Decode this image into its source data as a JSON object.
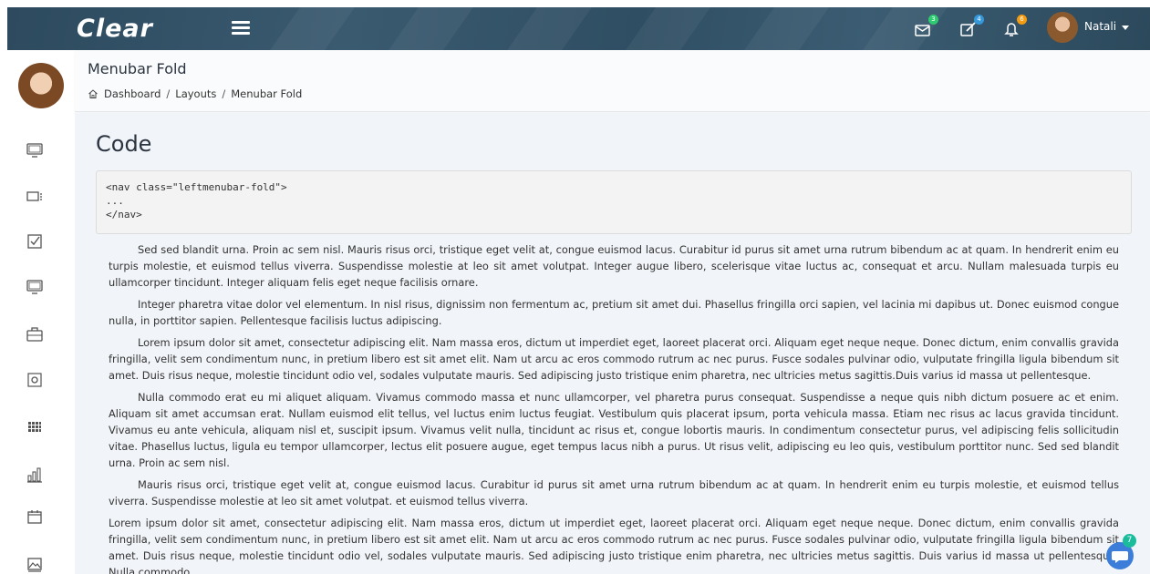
{
  "app": {
    "logo": "Clear"
  },
  "topbar": {
    "mail_badge": "3",
    "edit_badge": "4",
    "bell_badge": "6",
    "user_name": "Natali",
    "colors": {
      "mail_badge": "#2ecc71",
      "edit_badge": "#3498db",
      "bell_badge": "#f39c12"
    }
  },
  "header": {
    "title": "Menubar Fold",
    "breadcrumb": [
      "Dashboard",
      "Layouts",
      "Menubar Fold"
    ],
    "separator": "/"
  },
  "sidebar": {
    "icons": [
      "monitor-icon",
      "tag-icon",
      "checkbox-icon",
      "screen-icon",
      "briefcase-icon",
      "settings-icon",
      "grid-icon",
      "bar-chart-icon",
      "calendar-icon",
      "image-icon"
    ]
  },
  "content": {
    "section_title": "Code",
    "code": "<nav class=\"leftmenubar-fold\">\n...\n</nav>",
    "paragraphs": [
      "Sed sed blandit urna. Proin ac sem nisl. Mauris risus orci, tristique eget velit at, congue euismod lacus. Curabitur id purus sit amet urna rutrum bibendum ac at quam. In hendrerit enim eu turpis molestie, et euismod tellus viverra. Suspendisse molestie at leo sit amet volutpat. Integer augue libero, scelerisque vitae luctus ac, consequat et arcu. Nullam malesuada turpis eu ullamcorper tincidunt. Integer aliquam felis eget neque facilisis ornare.",
      "Integer pharetra vitae dolor vel elementum. In nisl risus, dignissim non fermentum ac, pretium sit amet dui. Phasellus fringilla orci sapien, vel lacinia mi dapibus ut. Donec euismod congue nulla, in porttitor sapien. Pellentesque facilisis luctus adipiscing.",
      "Lorem ipsum dolor sit amet, consectetur adipiscing elit. Nam massa eros, dictum ut imperdiet eget, laoreet placerat orci. Aliquam eget neque neque. Donec dictum, enim convallis gravida fringilla, velit sem condimentum nunc, in pretium libero est sit amet elit. Nam ut arcu ac eros commodo rutrum ac nec purus. Fusce sodales pulvinar odio, vulputate fringilla ligula bibendum sit amet. Duis risus neque, molestie tincidunt odio vel, sodales vulputate mauris. Sed adipiscing justo tristique enim pharetra, nec ultricies metus sagittis.Duis varius id massa ut pellentesque.",
      "Nulla commodo erat eu mi aliquet aliquam. Vivamus commodo massa et nunc ullamcorper, vel pharetra purus consequat. Suspendisse a neque quis nibh dictum posuere ac et enim. Aliquam sit amet accumsan erat. Nullam euismod elit tellus, vel luctus enim luctus feugiat. Vestibulum quis placerat ipsum, porta vehicula massa. Etiam nec risus ac lacus gravida tincidunt. Vivamus eu ante vehicula, aliquam nisl et, suscipit ipsum. Vivamus velit nulla, tincidunt ac risus et, congue lobortis mauris. In condimentum consectetur purus, vel adipiscing felis sollicitudin vitae. Phasellus luctus, ligula eu tempor ullamcorper, lectus elit posuere augue, eget tempus lacus nibh a purus. Ut risus velit, adipiscing eu leo quis, vestibulum porttitor nunc. Sed sed blandit urna. Proin ac sem nisl.",
      "Mauris risus orci, tristique eget velit at, congue euismod lacus. Curabitur id purus sit amet urna rutrum bibendum ac at quam. In hendrerit enim eu turpis molestie, et euismod tellus viverra. Suspendisse molestie at leo sit amet volutpat. et euismod tellus viverra.",
      "Lorem ipsum dolor sit amet, consectetur adipiscing elit. Nam massa eros, dictum ut imperdiet eget, laoreet placerat orci. Aliquam eget neque neque. Donec dictum, enim convallis gravida fringilla, velit sem condimentum nunc, in pretium libero est sit amet elit. Nam ut arcu ac eros commodo rutrum ac nec purus. Fusce sodales pulvinar odio, vulputate fringilla ligula bibendum sit amet. Duis risus neque, molestie tincidunt odio vel, sodales vulputate mauris. Sed adipiscing justo tristique enim pharetra, nec ultricies metus sagittis. Duis varius id massa ut pellentesque. Nulla commodo"
    ]
  },
  "chat": {
    "badge": "7"
  }
}
